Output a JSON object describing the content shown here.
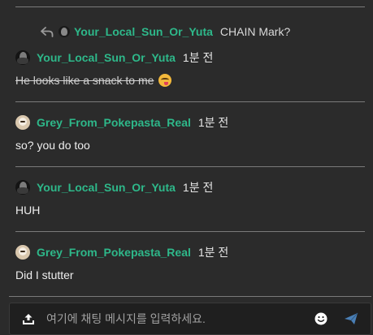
{
  "reply": {
    "author": "Your_Local_Sun_Or_Yuta",
    "text": "CHAIN Mark?"
  },
  "messages": [
    {
      "author": "Your_Local_Sun_Or_Yuta",
      "time": "1분 전",
      "text": "He looks like a snack to me",
      "emoji": "face-savoring-food",
      "strikethrough": true,
      "avatar": "dark"
    },
    {
      "author": "Grey_From_Pokepasta_Real",
      "time": "1분 전",
      "text": "so? you do too",
      "avatar": "light"
    },
    {
      "author": "Your_Local_Sun_Or_Yuta",
      "time": "1분 전",
      "text": "HUH",
      "avatar": "dark"
    },
    {
      "author": "Grey_From_Pokepasta_Real",
      "time": "1분 전",
      "text": "Did I stutter",
      "avatar": "light"
    }
  ],
  "input": {
    "placeholder": "여기에 채팅 메시지를 입력하세요.",
    "value": ""
  },
  "icons": {
    "reply": "reply-arrow-icon",
    "upload": "upload-icon",
    "emoji": "smiley-icon",
    "send": "send-icon"
  },
  "colors": {
    "accent": "#2eb88a",
    "background": "#2b2b2b",
    "send": "#4a7fb5"
  }
}
